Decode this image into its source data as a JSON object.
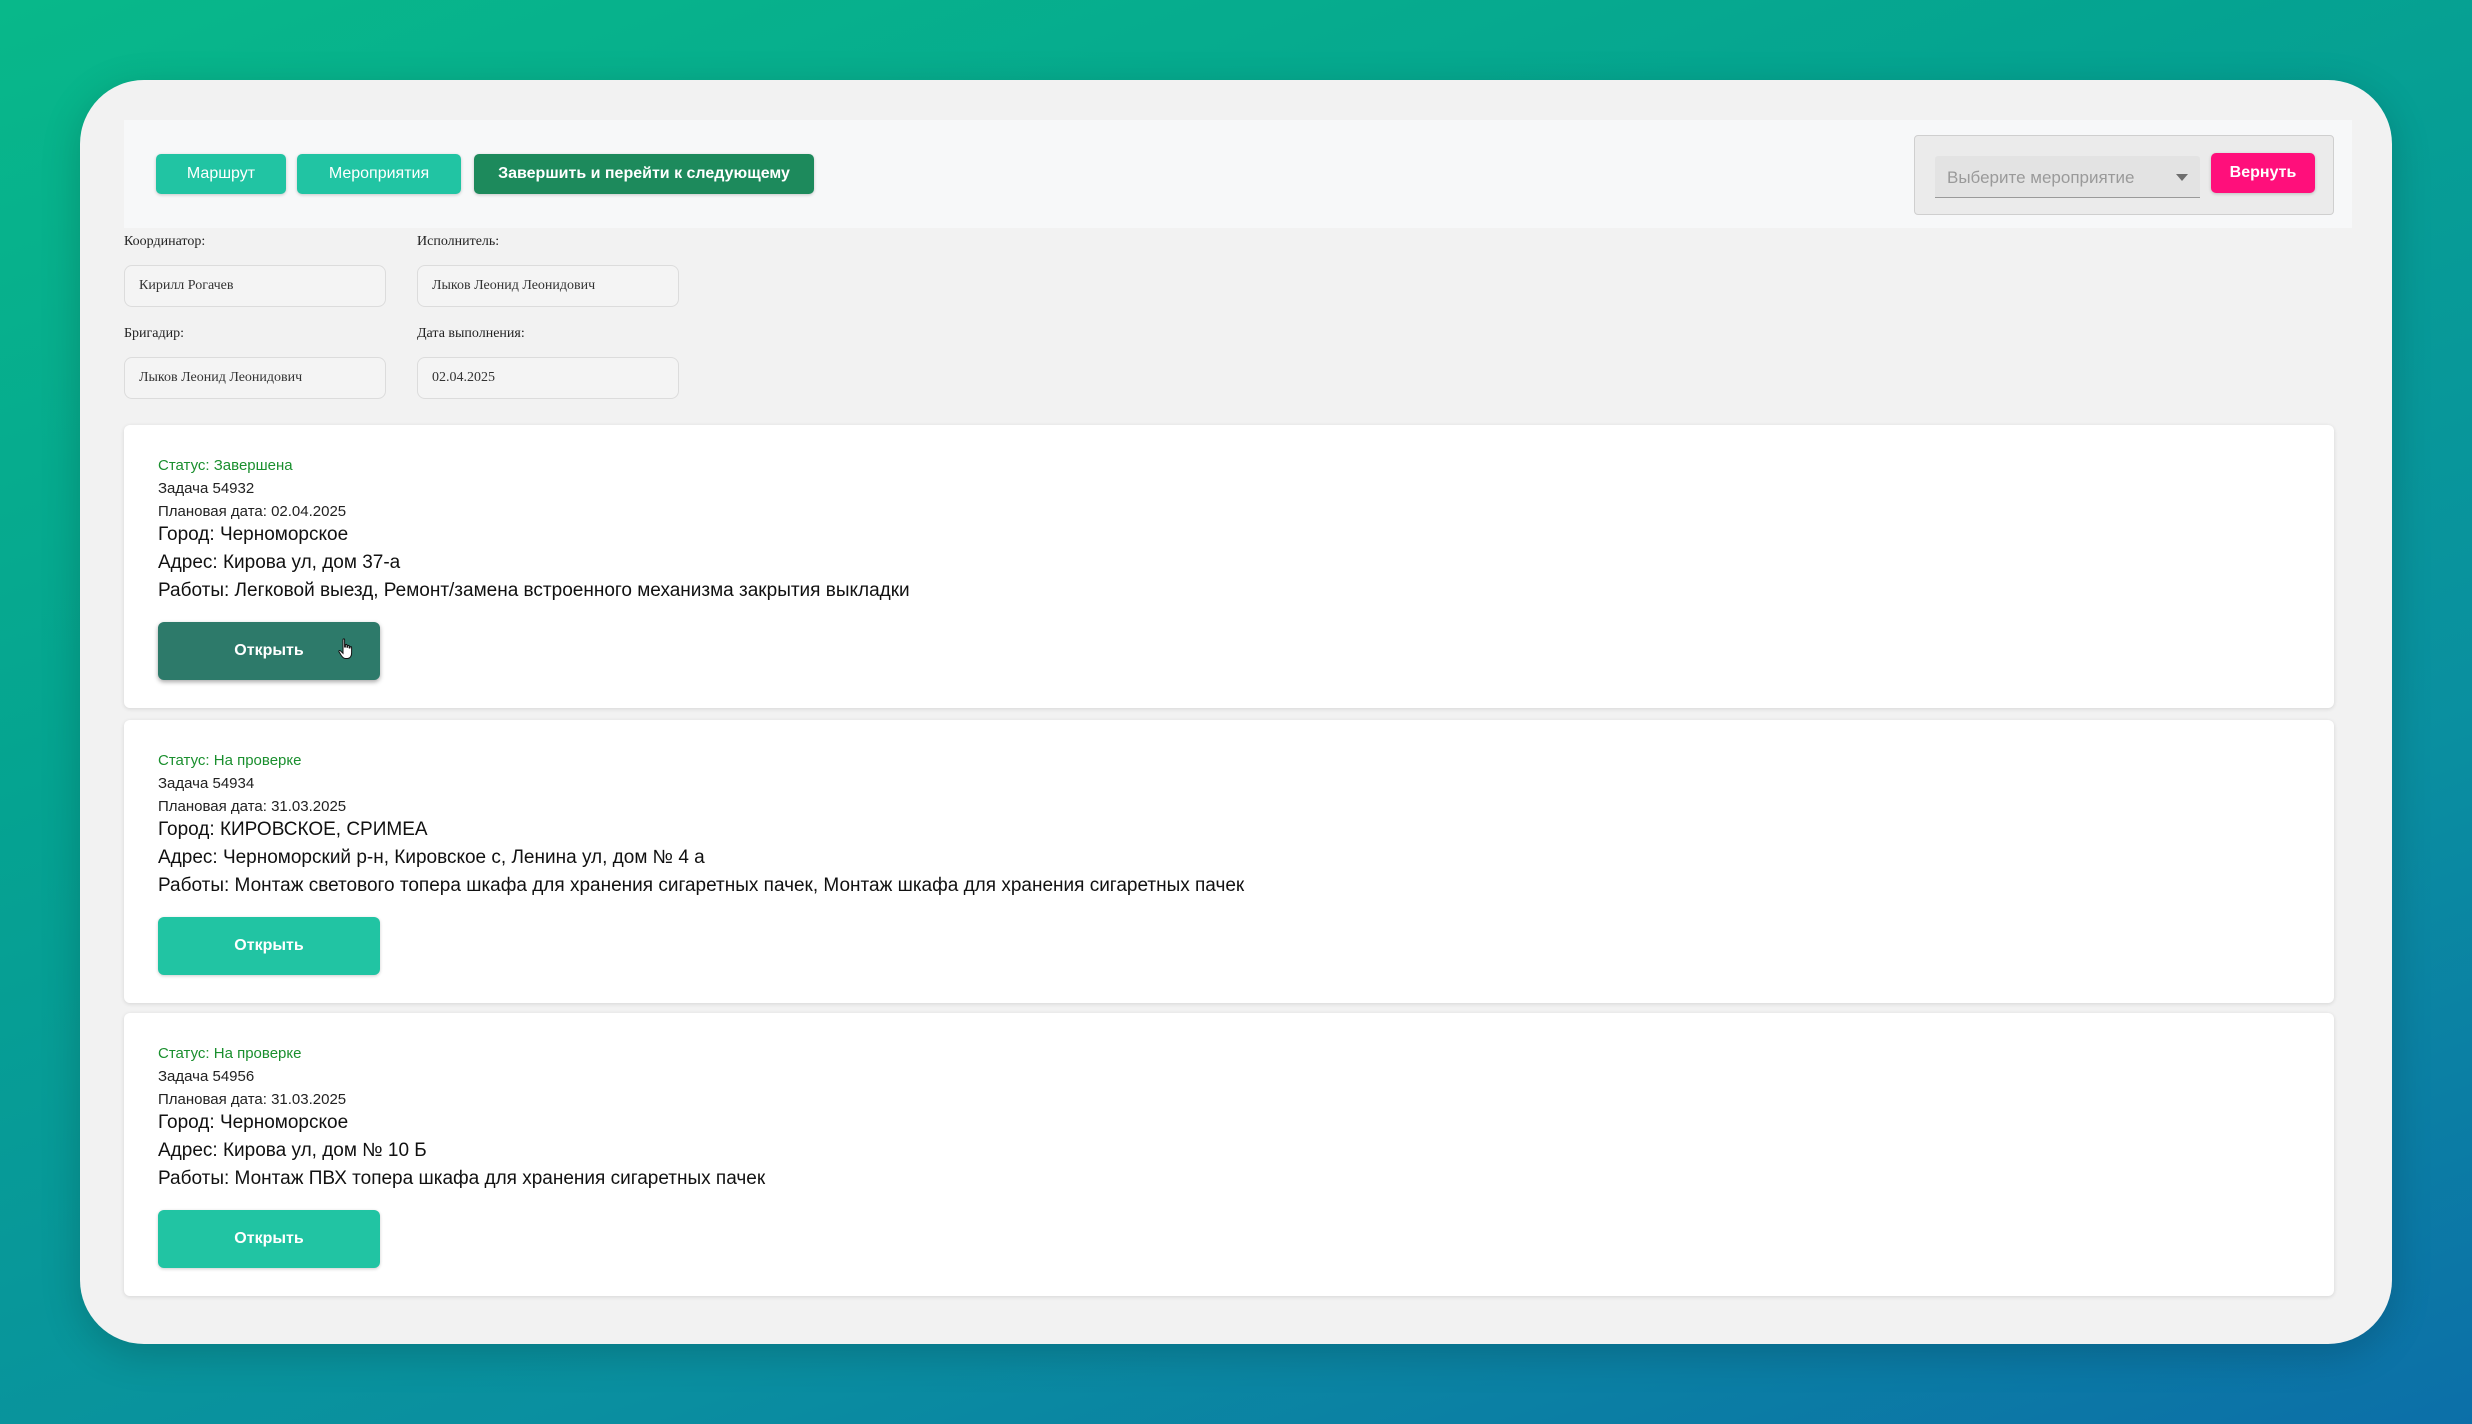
{
  "toolbar": {
    "route_label": "Маршрут",
    "events_label": "Мероприятия",
    "finish_label": "Завершить и перейти к следующему",
    "select_placeholder": "Выберите мероприятие",
    "return_label": "Вернуть"
  },
  "fields": {
    "coordinator_label": "Координатор:",
    "coordinator_value": "Кирилл Рогачев",
    "executor_label": "Исполнитель:",
    "executor_value": "Лыков Леонид Леонидович",
    "foreman_label": "Бригадир:",
    "foreman_value": "Лыков Леонид Леонидович",
    "date_label": "Дата выполнения:",
    "date_value": "02.04.2025"
  },
  "tasks": [
    {
      "status": "Статус: Завершена",
      "task": "Задача 54932",
      "plan_date": "Плановая дата: 02.04.2025",
      "city": "Город: Черноморское",
      "address": "Адрес: Кирова ул, дом 37-а",
      "works": "Работы: Легковой выезд, Ремонт/замена встроенного механизма закрытия выкладки",
      "open_label": "Открыть"
    },
    {
      "status": "Статус: На проверке",
      "task": "Задача 54934",
      "plan_date": "Плановая дата: 31.03.2025",
      "city": "Город: КИРОВСКОЕ, CРИМЕА",
      "address": "Адрес: Черноморский р-н, Кировское с, Ленина ул, дом № 4 а",
      "works": "Работы: Монтаж светового топера шкафа для хранения сигаретных пачек, Монтаж шкафа для хранения сигаретных пачек",
      "open_label": "Открыть"
    },
    {
      "status": "Статус: На проверке",
      "task": "Задача 54956",
      "plan_date": "Плановая дата: 31.03.2025",
      "city": "Город: Черноморское",
      "address": "Адрес: Кирова ул, дом № 10 Б",
      "works": "Работы: Монтаж ПВХ топера шкафа для хранения сигаретных пачек",
      "open_label": "Открыть"
    }
  ],
  "colors": {
    "teal": "#21c4a3",
    "dark_green": "#1d8a5c",
    "pink": "#ff0f7b",
    "status_green": "#1a8f2e",
    "active_open": "#2d7a6a"
  },
  "icons": {
    "dropdown": "chevron-down-icon",
    "cursor": "hand-pointer-icon"
  }
}
